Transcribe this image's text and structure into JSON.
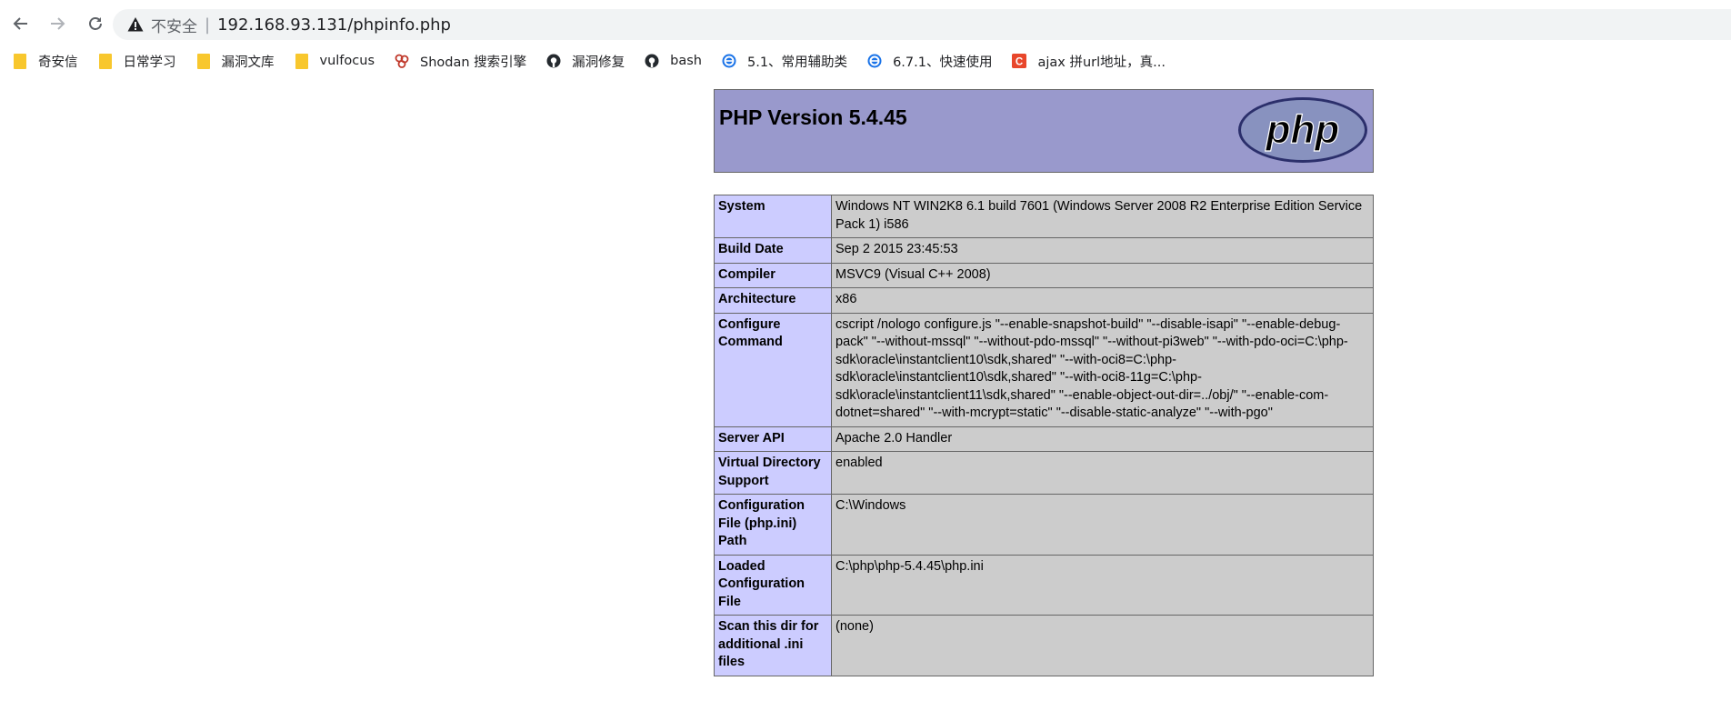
{
  "browser": {
    "security_label": "不安全",
    "separator": "|",
    "url": "192.168.93.131/phpinfo.php",
    "icons": {
      "back": "arrow-left-icon",
      "forward": "arrow-right-icon",
      "reload": "reload-icon",
      "warning": "warning-triangle-icon"
    }
  },
  "bookmarks": [
    {
      "label": "奇安信",
      "icon": "folder-icon"
    },
    {
      "label": "日常学习",
      "icon": "folder-icon"
    },
    {
      "label": "漏洞文库",
      "icon": "folder-icon"
    },
    {
      "label": "vulfocus",
      "icon": "folder-icon"
    },
    {
      "label": "Shodan 搜索引擎",
      "icon": "shodan-icon"
    },
    {
      "label": "漏洞修复",
      "icon": "github-icon"
    },
    {
      "label": "bash",
      "icon": "github-icon"
    },
    {
      "label": "5.1、常用辅助类",
      "icon": "blue-e-icon"
    },
    {
      "label": "6.7.1、快速使用",
      "icon": "blue-e-icon"
    },
    {
      "label": "ajax 拼url地址，真...",
      "icon": "csdn-icon"
    }
  ],
  "phpinfo": {
    "title": "PHP Version 5.4.45",
    "logo_text": "php",
    "colors": {
      "header_bg": "#9999cc",
      "key_bg": "#ccccff",
      "value_bg": "#cccccc"
    },
    "rows": [
      {
        "key": "System",
        "value": "Windows NT WIN2K8 6.1 build 7601 (Windows Server 2008 R2 Enterprise Edition Service Pack 1) i586"
      },
      {
        "key": "Build Date",
        "value": "Sep 2 2015 23:45:53"
      },
      {
        "key": "Compiler",
        "value": "MSVC9 (Visual C++ 2008)"
      },
      {
        "key": "Architecture",
        "value": "x86"
      },
      {
        "key": "Configure Command",
        "value": "cscript /nologo configure.js \"--enable-snapshot-build\" \"--disable-isapi\" \"--enable-debug-pack\" \"--without-mssql\" \"--without-pdo-mssql\" \"--without-pi3web\" \"--with-pdo-oci=C:\\php-sdk\\oracle\\instantclient10\\sdk,shared\" \"--with-oci8=C:\\php-sdk\\oracle\\instantclient10\\sdk,shared\" \"--with-oci8-11g=C:\\php-sdk\\oracle\\instantclient11\\sdk,shared\" \"--enable-object-out-dir=../obj/\" \"--enable-com-dotnet=shared\" \"--with-mcrypt=static\" \"--disable-static-analyze\" \"--with-pgo\""
      },
      {
        "key": "Server API",
        "value": "Apache 2.0 Handler"
      },
      {
        "key": "Virtual Directory Support",
        "value": "enabled"
      },
      {
        "key": "Configuration File (php.ini) Path",
        "value": "C:\\Windows"
      },
      {
        "key": "Loaded Configuration File",
        "value": "C:\\php\\php-5.4.45\\php.ini"
      },
      {
        "key": "Scan this dir for additional .ini files",
        "value": "(none)"
      }
    ]
  }
}
